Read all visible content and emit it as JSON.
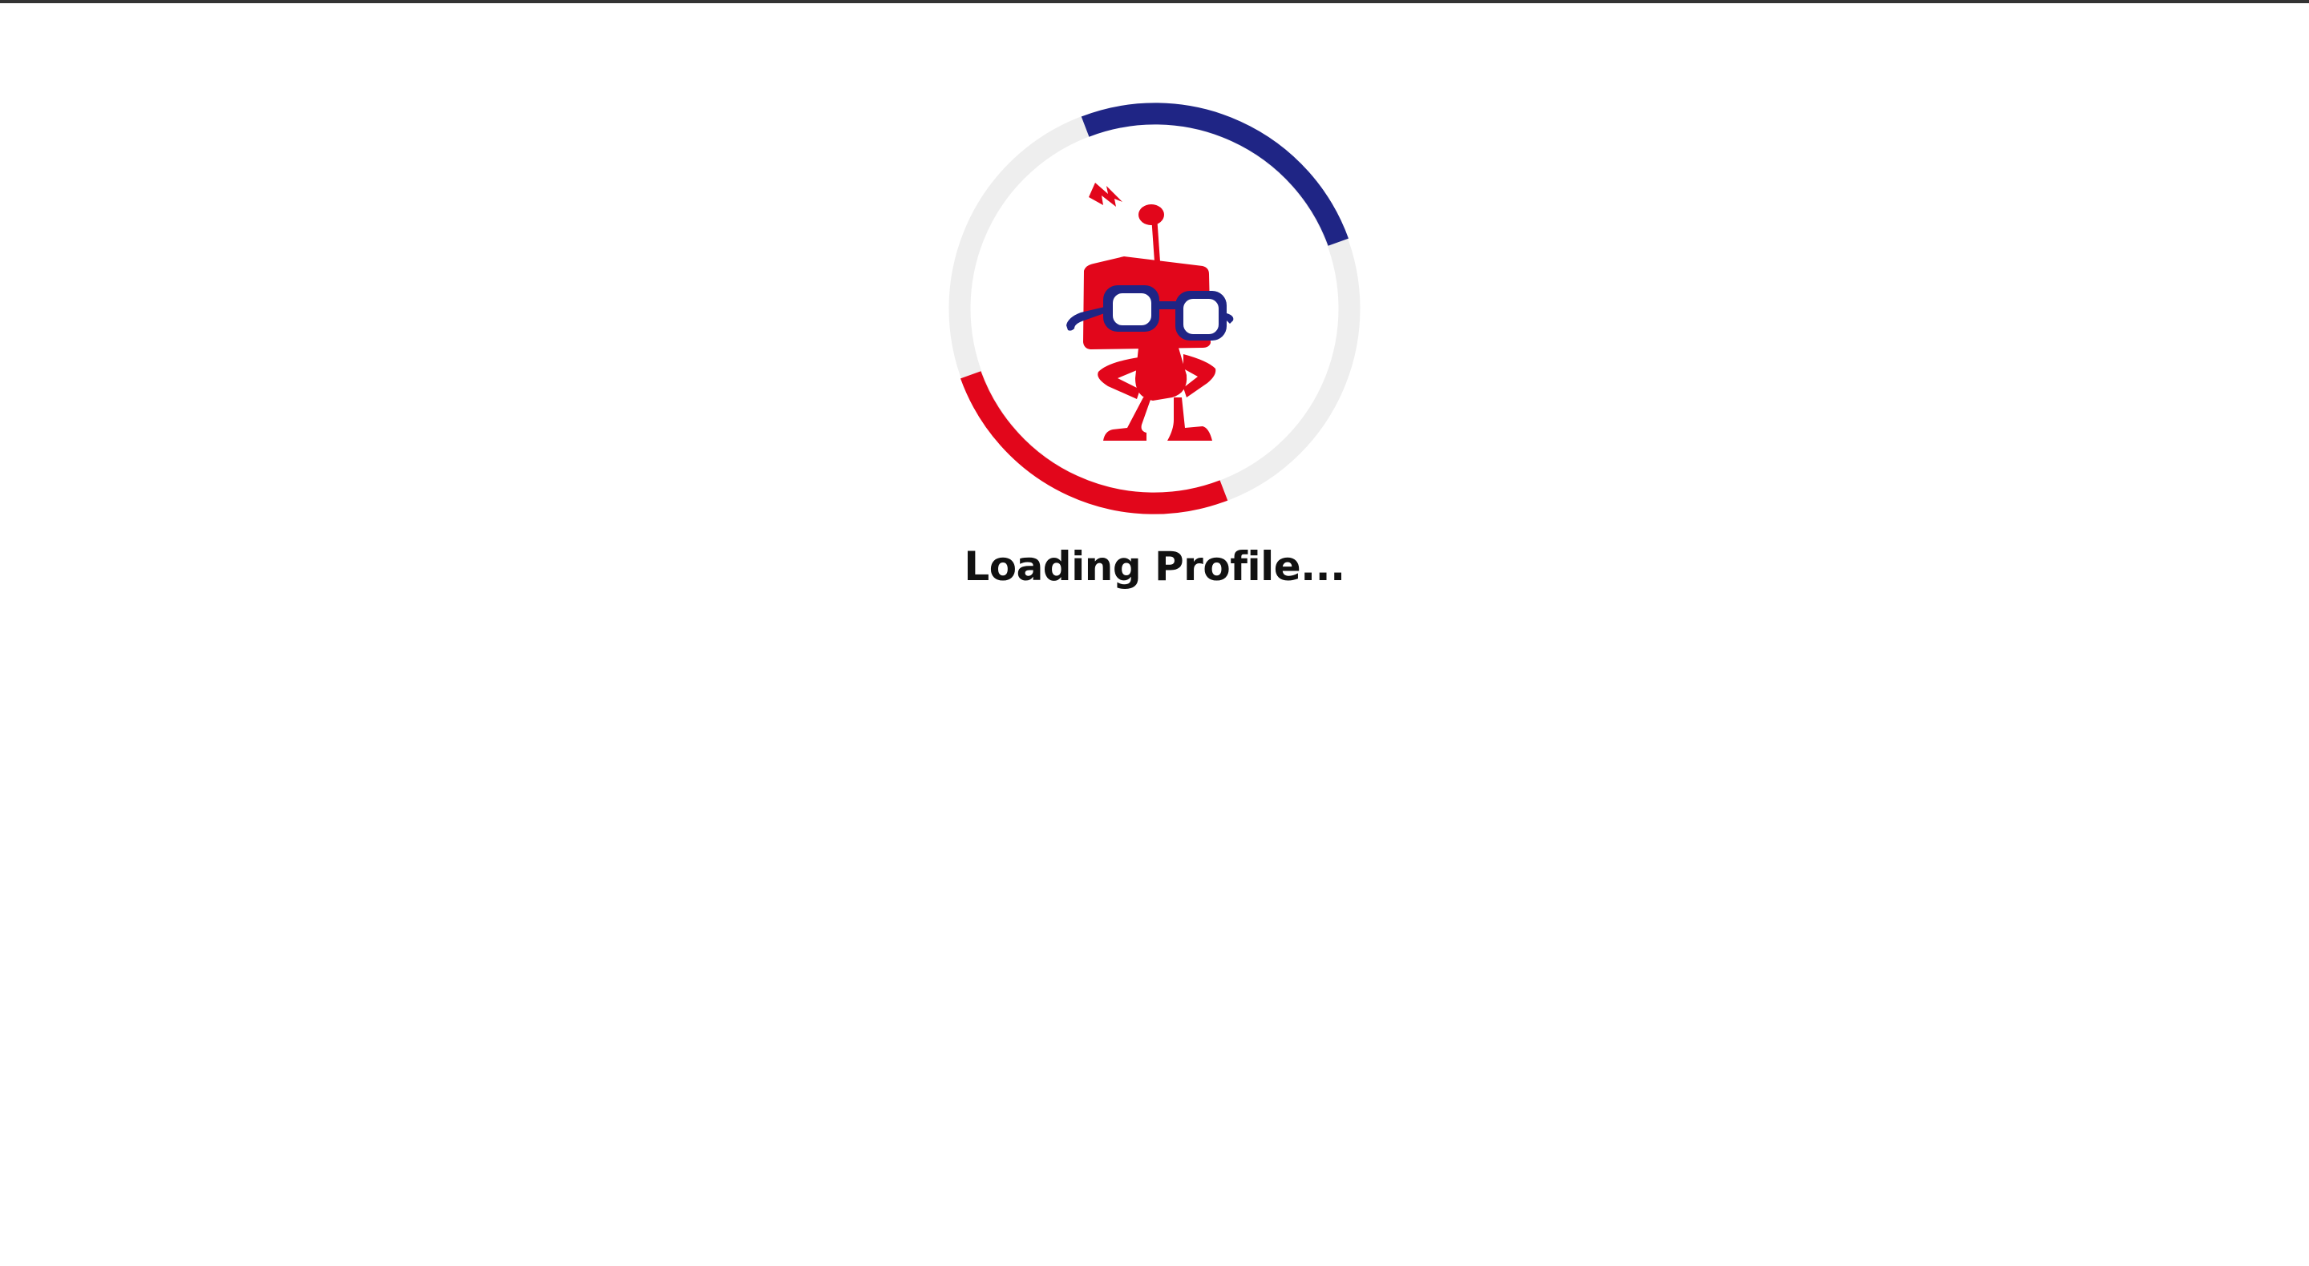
{
  "loader": {
    "text": "Loading Profile...",
    "colors": {
      "track": "#eeeeee",
      "arc_primary": "#1f2585",
      "arc_secondary": "#e2061b",
      "mascot_body": "#e2061b",
      "mascot_glasses": "#1f2585",
      "text": "#111111"
    },
    "icons": [
      "loading-spinner-icon",
      "robot-mascot-icon"
    ]
  }
}
